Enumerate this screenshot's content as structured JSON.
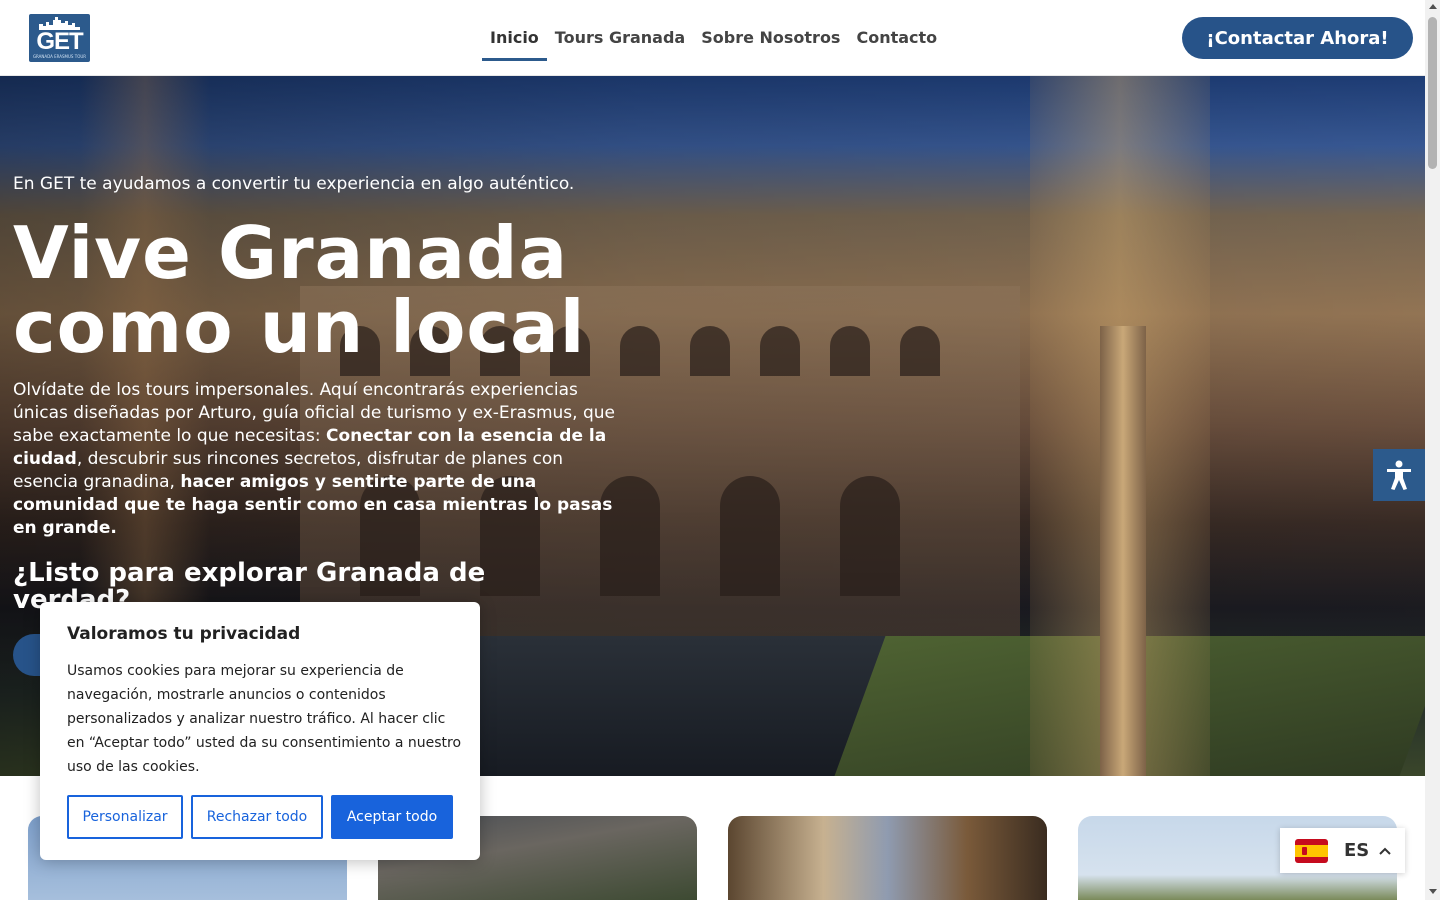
{
  "header": {
    "logo_text": "GET",
    "logo_subtext": "GRANADA ERASMUS TOUR",
    "nav": [
      {
        "label": "Inicio",
        "active": true
      },
      {
        "label": "Tours Granada",
        "active": false
      },
      {
        "label": "Sobre Nosotros",
        "active": false
      },
      {
        "label": "Contacto",
        "active": false
      }
    ],
    "cta_label": "¡Contactar Ahora!"
  },
  "hero": {
    "tagline": "En GET te ayudamos a convertir tu experiencia en algo auténtico.",
    "title_line1": "Vive Granada",
    "title_line2": "como un local",
    "body_1": "Olvídate de los tours impersonales. Aquí encontrarás experiencias únicas diseñadas por Arturo, guía oficial de turismo y ex-Erasmus, que sabe exactamente lo que necesitas: ",
    "body_bold_1": "Conectar con la esencia de la ciudad",
    "body_2": ", descubrir sus rincones secretos, disfrutar de planes con esencia granadina, ",
    "body_bold_2": "hacer amigos y sentirte parte de una comunidad que te haga sentir como en casa mientras lo pasas en grande.",
    "question": "¿Listo para explorar Granada de verdad?"
  },
  "cookie": {
    "title": "Valoramos tu privacidad",
    "text": "Usamos cookies para mejorar su experiencia de navegación, mostrarle anuncios o contenidos personalizados y analizar nuestro tráfico. Al hacer clic en “Aceptar todo” usted da su consentimiento a nuestro uso de las cookies.",
    "customize_label": "Personalizar",
    "reject_label": "Rechazar todo",
    "accept_label": "Aceptar todo"
  },
  "language": {
    "code": "ES",
    "flag": "spain-flag-icon"
  },
  "colors": {
    "brand": "#275389",
    "cookie_accent": "#1863dc"
  }
}
